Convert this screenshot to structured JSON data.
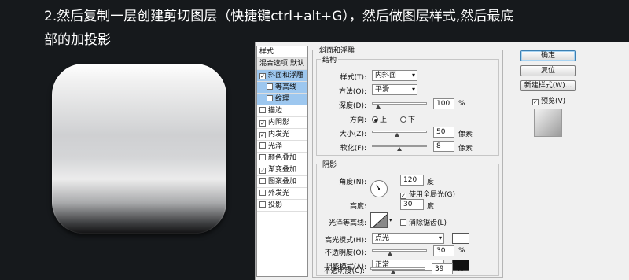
{
  "instruction": {
    "line1": "2.然后复制一层创建剪切图层（快捷键ctrl+alt+G），然后做图层样式,然后最底",
    "line2": "部的加投影"
  },
  "dialog": {
    "styles_header": "样式",
    "blend_options": "混合选项:默认",
    "styles": [
      {
        "label": "斜面和浮雕",
        "checked": true
      },
      {
        "label": "等高线",
        "checked": false
      },
      {
        "label": "纹理",
        "checked": false
      },
      {
        "label": "描边",
        "checked": false
      },
      {
        "label": "内阴影",
        "checked": true
      },
      {
        "label": "内发光",
        "checked": true
      },
      {
        "label": "光泽",
        "checked": false
      },
      {
        "label": "颜色叠加",
        "checked": false
      },
      {
        "label": "渐变叠加",
        "checked": true
      },
      {
        "label": "图案叠加",
        "checked": false
      },
      {
        "label": "外发光",
        "checked": false
      },
      {
        "label": "投影",
        "checked": false
      }
    ],
    "bevel": {
      "panel_title": "斜面和浮雕",
      "group_title": "结构",
      "style_label": "样式(T):",
      "style_value": "内斜面",
      "technique_label": "方法(Q):",
      "technique_value": "平滑",
      "depth_label": "深度(D):",
      "depth_value": "100",
      "depth_unit": "%",
      "direction_label": "方向:",
      "dir_up": "上",
      "dir_down": "下",
      "size_label": "大小(Z):",
      "size_value": "50",
      "size_unit": "像素",
      "soften_label": "软化(F):",
      "soften_value": "8",
      "soften_unit": "像素"
    },
    "shading": {
      "group_title": "阴影",
      "angle_label": "角度(N):",
      "angle_value": "120",
      "angle_unit": "度",
      "global_light": "使用全局光(G)",
      "altitude_label": "高度:",
      "altitude_value": "30",
      "altitude_unit": "度",
      "gloss_label": "光泽等高线:",
      "antialias": "消除锯齿(L)",
      "highlight_label": "高光模式(H):",
      "highlight_value": "点光",
      "highlight_color": "#ffffff",
      "opacity1_label": "不透明度(O):",
      "opacity1_value": "30",
      "opacity_unit": "%",
      "shadow_label": "阴影模式(A):",
      "shadow_value": "正常",
      "shadow_color": "#111111",
      "opacity2_label": "不透明度(C):",
      "opacity2_value": "39"
    },
    "buttons": {
      "ok": "确定",
      "reset": "复位",
      "new_style": "新建样式(W)...",
      "preview": "预览(V)"
    }
  }
}
